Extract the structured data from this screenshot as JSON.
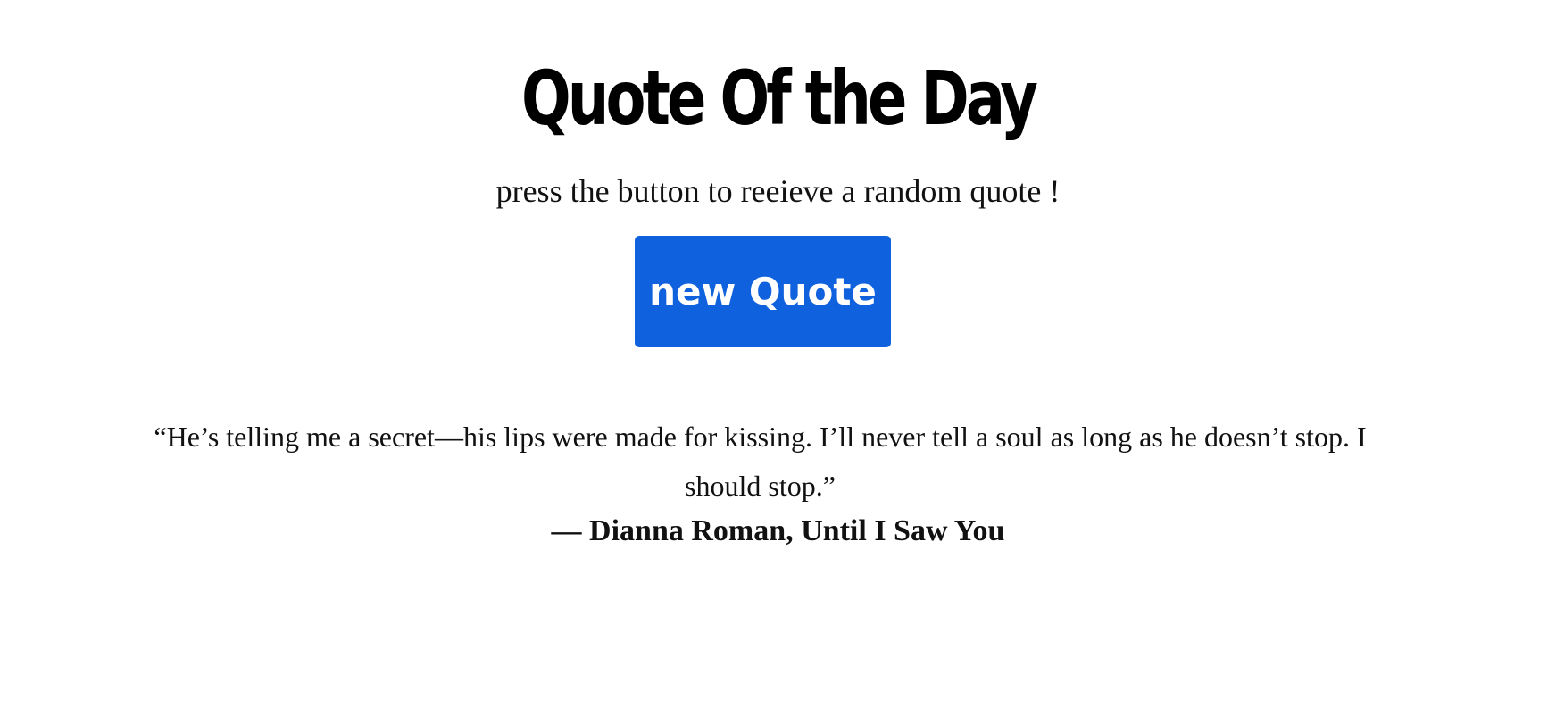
{
  "header": {
    "title": "Quote Of the Day",
    "subtitle": "press the button to reeieve a random quote !"
  },
  "controls": {
    "new_quote_label": "new Quote"
  },
  "quote": {
    "text": "“He’s telling me a secret—his lips were made for kissing. I’ll never tell a soul as long as he doesn’t stop. I should stop.”",
    "author": "— Dianna Roman, Until I Saw You"
  },
  "colors": {
    "button_background": "#1061dd",
    "button_text": "#ffffff",
    "page_background": "#ffffff",
    "text": "#111111"
  }
}
